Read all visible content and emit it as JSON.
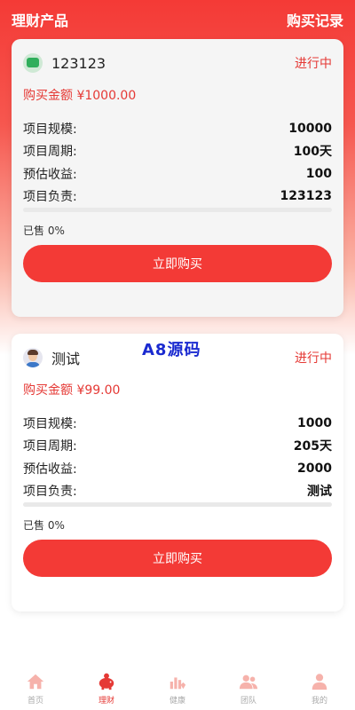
{
  "header": {
    "title": "理财产品",
    "records_link": "购买记录"
  },
  "products": [
    {
      "name": "123123",
      "status": "进行中",
      "amount": "购买金额 ¥1000.00",
      "rows": [
        {
          "label": "项目规模:",
          "value": "10000"
        },
        {
          "label": "项目周期:",
          "value": "100天"
        },
        {
          "label": "预估收益:",
          "value": "100"
        },
        {
          "label": "项目负责:",
          "value": "123123"
        }
      ],
      "progress_percent": 0,
      "sold": "已售 0%",
      "buy_label": "立即购买"
    },
    {
      "name": "测试",
      "status": "进行中",
      "amount": "购买金额 ¥99.00",
      "rows": [
        {
          "label": "项目规模:",
          "value": "1000"
        },
        {
          "label": "项目周期:",
          "value": "205天"
        },
        {
          "label": "预估收益:",
          "value": "2000"
        },
        {
          "label": "项目负责:",
          "value": "测试"
        }
      ],
      "progress_percent": 0,
      "sold": "已售 0%",
      "buy_label": "立即购买"
    }
  ],
  "watermark": "A8源码",
  "tabbar": {
    "items": [
      {
        "label": "首页",
        "icon": "home-icon",
        "active": false
      },
      {
        "label": "理财",
        "icon": "piggy-bank-icon",
        "active": true
      },
      {
        "label": "健康",
        "icon": "health-chart-icon",
        "active": false
      },
      {
        "label": "团队",
        "icon": "team-icon",
        "active": false
      },
      {
        "label": "我的",
        "icon": "user-icon",
        "active": false
      }
    ]
  },
  "colors": {
    "accent": "#f33a36",
    "inactive_icon": "#f6b2ab",
    "active_label": "#e53935"
  }
}
